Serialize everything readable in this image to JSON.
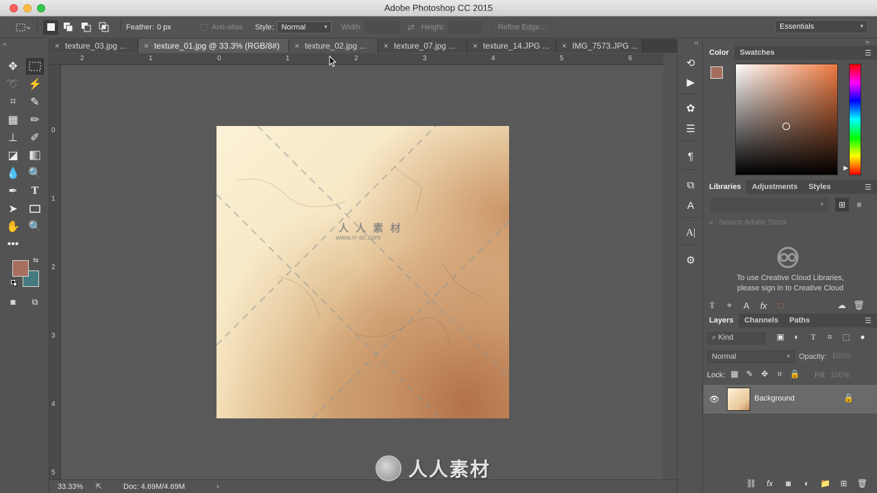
{
  "window": {
    "title": "Adobe Photoshop CC 2015",
    "watermark": "www.rr-sc.com"
  },
  "options_bar": {
    "feather_label": "Feather:",
    "feather_value": "0 px",
    "antialias_label": "Anti-alias",
    "style_label": "Style:",
    "style_value": "Normal",
    "width_label": "Width:",
    "height_label": "Height:",
    "refine_edge_label": "Refine Edge..."
  },
  "workspace": {
    "selected": "Essentials"
  },
  "tabs": [
    {
      "label": "texture_03.jpg ..."
    },
    {
      "label": "texture_01.jpg @ 33.3% (RGB/8#)"
    },
    {
      "label": "texture_02.jpg ..."
    },
    {
      "label": "texture_07.jpg ..."
    },
    {
      "label": "texture_14.JPG ..."
    },
    {
      "label": "IMG_7573.JPG ..."
    }
  ],
  "ruler": {
    "top_numbers": [
      "2",
      "1",
      "0",
      "1",
      "2",
      "3",
      "4",
      "5",
      "6"
    ],
    "left_numbers": [
      "0",
      "1",
      "2",
      "3",
      "4",
      "5"
    ]
  },
  "status_bar": {
    "zoom": "33.33%",
    "doc_info": "Doc: 4.69M/4.69M"
  },
  "color_panel": {
    "tabs": [
      "Color",
      "Swatches"
    ],
    "foreground": "#a66e5e",
    "background": "#447a80"
  },
  "libraries_panel": {
    "tabs": [
      "Libraries",
      "Adjustments",
      "Styles"
    ],
    "search_placeholder": "Search Adobe Stock",
    "message_line1": "To use Creative Cloud Libraries,",
    "message_line2": "please sign in to Creative Cloud"
  },
  "layers_panel": {
    "tabs": [
      "Layers",
      "Channels",
      "Paths"
    ],
    "filter_label": "Kind",
    "blend_mode": "Normal",
    "opacity_label": "Opacity:",
    "opacity_value": "100%",
    "lock_label": "Lock:",
    "fill_label": "Fill:",
    "fill_value": "100%",
    "layers": [
      {
        "name": "Background",
        "visible": true,
        "locked": true
      }
    ]
  },
  "watermark_logo": {
    "text": "人人素材",
    "doc_text": "人 人 素 材",
    "doc_url": "www.rr-sc.com"
  },
  "icons": {
    "tools": [
      "move-icon",
      "rect-marquee-icon",
      "lasso-icon",
      "magic-wand-icon",
      "crop-icon",
      "eyedropper-icon",
      "healing-icon",
      "brush-icon",
      "stamp-icon",
      "history-brush-icon",
      "eraser-icon",
      "gradient-icon",
      "blur-icon",
      "dodge-icon",
      "pen-icon",
      "type-icon",
      "path-select-icon",
      "rectangle-icon",
      "hand-icon",
      "zoom-icon",
      "more-tools-icon"
    ]
  }
}
